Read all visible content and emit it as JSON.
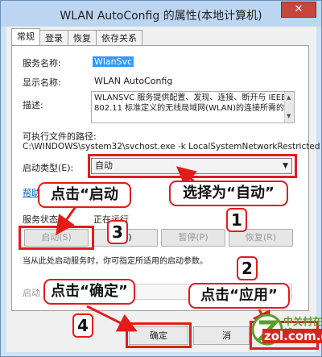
{
  "window": {
    "title": "WLAN AutoConfig 的属性(本地计算机)",
    "close_label": "✕"
  },
  "tabs": [
    {
      "label": "常规"
    },
    {
      "label": "登录"
    },
    {
      "label": "恢复"
    },
    {
      "label": "依存关系"
    }
  ],
  "general": {
    "service_name_label": "服务名称:",
    "service_name_value": "WlanSvc",
    "display_name_label": "显示名称:",
    "display_name_value": "WLAN AutoConfig",
    "description_label": "描述:",
    "description_value": "WLANSVC 服务提供配置、发现、连接、断开与 IEEE 802.11 标准定义的无线局域网(WLAN)的连接所需的",
    "exe_path_label": "可执行文件的路径:",
    "exe_path_value": "C:\\WINDOWS\\system32\\svchost.exe -k LocalSystemNetworkRestricted",
    "startup_type_label": "启动类型(E):",
    "startup_type_value": "自动",
    "help_link": "帮助",
    "service_status_label": "服务状态:",
    "service_status_value": "正在运行",
    "buttons": {
      "start": "启动(S)",
      "stop": "(T)",
      "pause": "暂停(P)",
      "resume": "恢复(R)"
    },
    "note": "当从此处启动服务时，你可指定所适用的启动参数。",
    "start_params_label": "启动"
  },
  "dialog_buttons": {
    "ok": "确定",
    "cancel": "消"
  },
  "annotations": {
    "select_auto": "选择为“自动”",
    "click_start": "点击“启动",
    "click_ok": "点击“确定”",
    "click_apply": "点击“应用”",
    "step1": "1",
    "step2": "2",
    "step3": "3",
    "step4": "4"
  },
  "watermark": {
    "cn_text": "中关村在线",
    "domain": "zol.com.cn"
  },
  "colors": {
    "annotation_red": "#e21b1b",
    "selection_blue": "#3399ff",
    "window_frame": "#bcd6f1",
    "close_button": "#c7463b"
  }
}
